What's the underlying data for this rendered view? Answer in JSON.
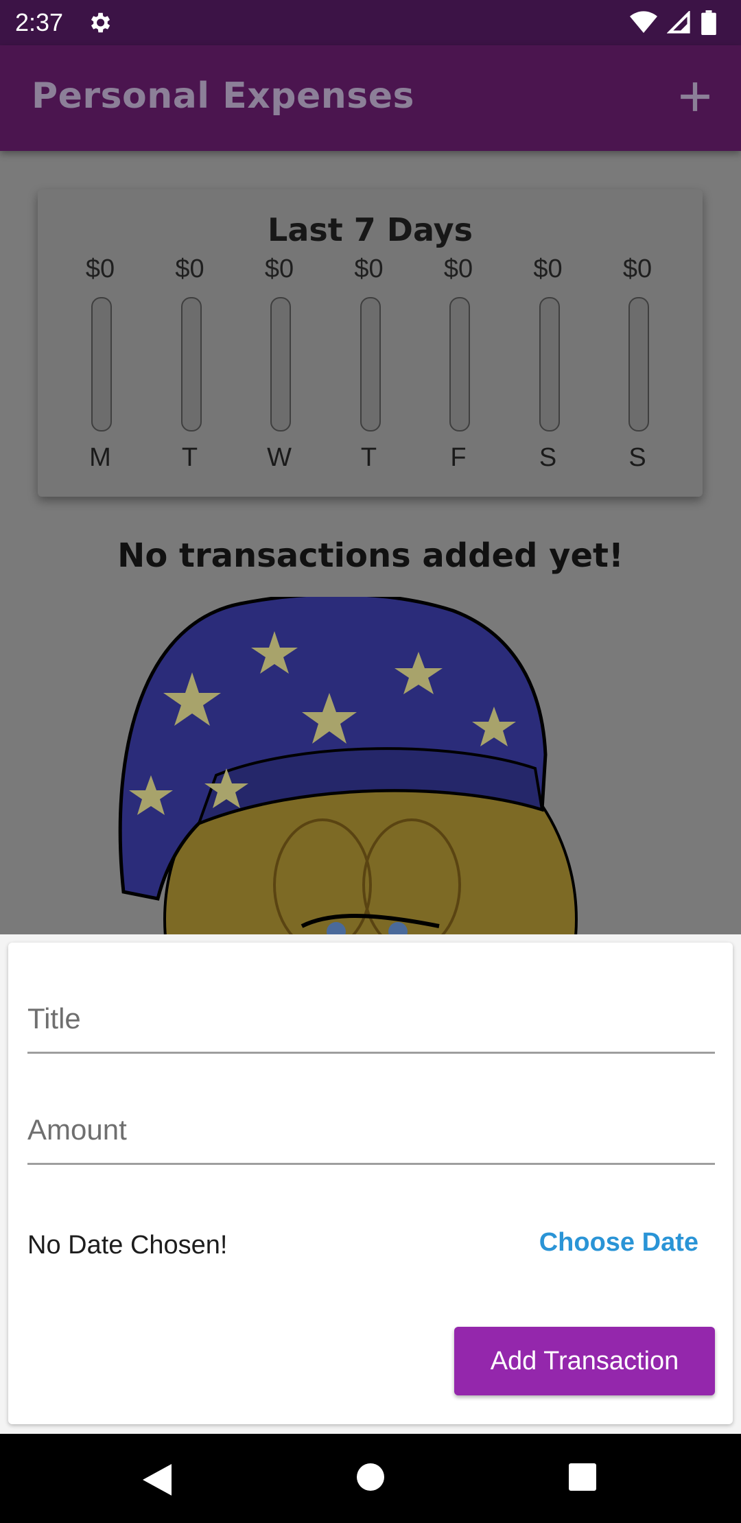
{
  "status_bar": {
    "time": "2:37",
    "icons": [
      "settings-icon",
      "wifi-icon",
      "signal-icon",
      "battery-icon"
    ]
  },
  "app_bar": {
    "title": "Personal Expenses",
    "action_icon": "add-icon"
  },
  "chart_card": {
    "title": "Last 7 Days",
    "chart_data": {
      "type": "bar",
      "title": "Last 7 Days",
      "categories": [
        "M",
        "T",
        "W",
        "T",
        "F",
        "S",
        "S"
      ],
      "value_labels": [
        "$0",
        "$0",
        "$0",
        "$0",
        "$0",
        "$0",
        "$0"
      ],
      "values": [
        0,
        0,
        0,
        0,
        0,
        0,
        0
      ],
      "fill_fraction": [
        0,
        0,
        0,
        0,
        0,
        0,
        0
      ]
    }
  },
  "empty_state": {
    "message": "No transactions added yet!",
    "image": "sleeping-emoji-image"
  },
  "form": {
    "title_placeholder": "Title",
    "title_value": "",
    "amount_placeholder": "Amount",
    "amount_value": "",
    "date_label": "No Date Chosen!",
    "choose_date_label": "Choose Date",
    "submit_label": "Add Transaction"
  },
  "colors": {
    "app_bar": "#4b154f",
    "accent_purple": "#9427ac",
    "link_blue": "#2a94d6",
    "scrim_gray": "#7a7a7a"
  },
  "nav_bar": {
    "icons": [
      "back-icon",
      "home-icon",
      "recents-icon"
    ]
  }
}
